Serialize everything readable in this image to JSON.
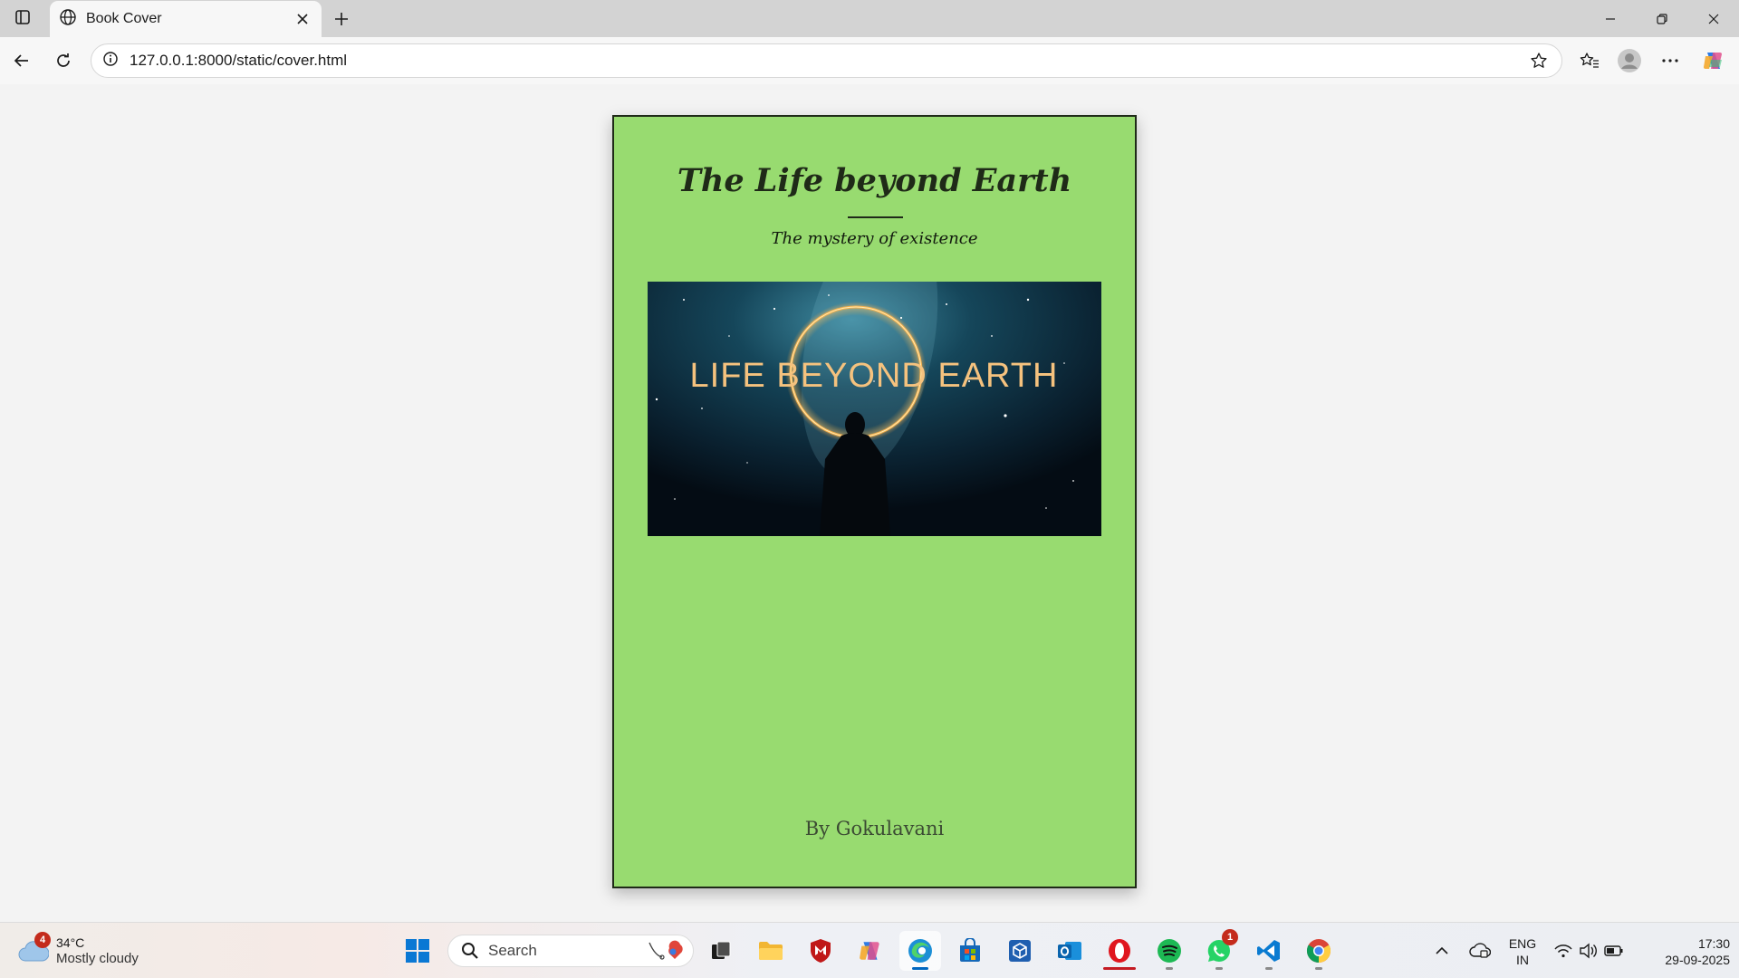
{
  "browser": {
    "tab": {
      "title": "Book Cover"
    },
    "address": {
      "url": "127.0.0.1:8000/static/cover.html"
    }
  },
  "book": {
    "title": "The Life beyond Earth",
    "subtitle": "The mystery of existence",
    "cover_image_text": "LIFE BEYOND EARTH",
    "author": "By Gokulavani",
    "background_color": "#98db70",
    "text_color": "#1f2a18"
  },
  "taskbar": {
    "weather": {
      "temperature": "34°C",
      "condition": "Mostly cloudy",
      "badge": "4"
    },
    "search_label": "Search",
    "whatsapp_badge": "1",
    "language": {
      "line1": "ENG",
      "line2": "IN"
    },
    "clock": {
      "time": "17:30",
      "date": "29-09-2025"
    }
  }
}
